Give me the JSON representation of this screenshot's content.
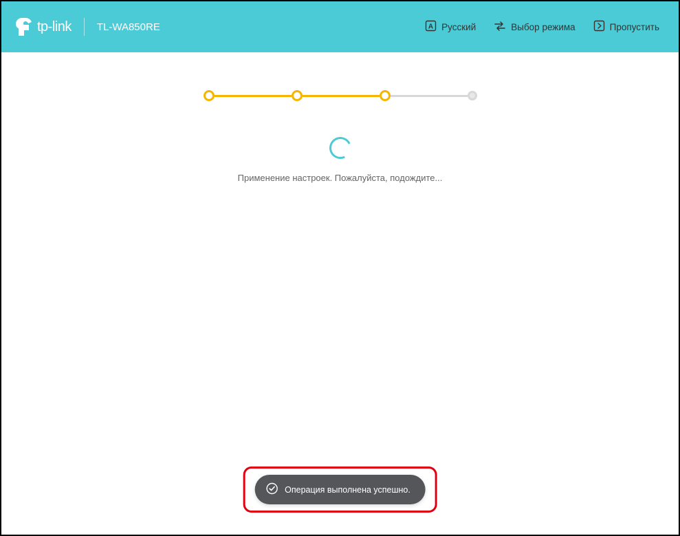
{
  "header": {
    "brand": "tp-link",
    "model": "TL-WA850RE",
    "nav": {
      "language": "Русский",
      "mode": "Выбор режима",
      "skip": "Пропустить"
    }
  },
  "progress": {
    "total_steps": 4,
    "completed_steps": 3
  },
  "main": {
    "status": "Применение настроек. Пожалуйста, подождите..."
  },
  "toast": {
    "message": "Операция выполнена успешно."
  },
  "colors": {
    "accent": "#4acbd6",
    "progress": "#f7b500",
    "toast_bg": "#54565a",
    "highlight_border": "#e1000f"
  }
}
